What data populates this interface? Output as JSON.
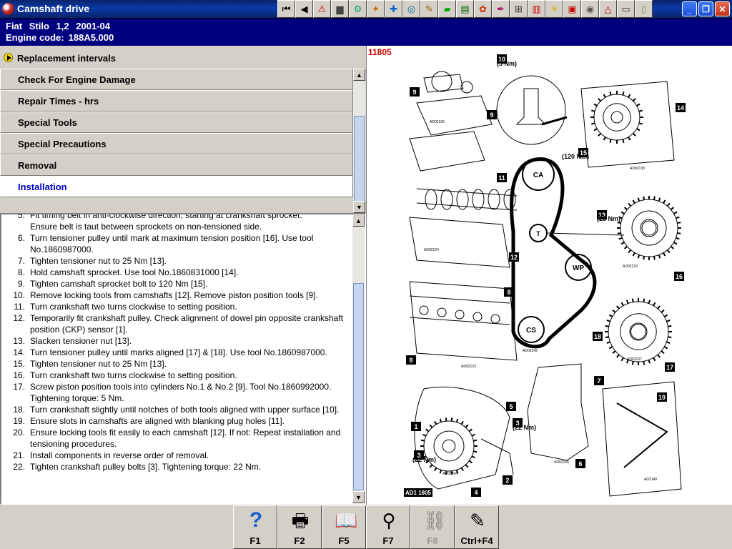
{
  "window": {
    "title": "Camshaft drive"
  },
  "toolbar": {
    "buttons": [
      {
        "name": "first-page-button",
        "glyph": "⏮"
      },
      {
        "name": "back-button",
        "glyph": "◀"
      },
      {
        "name": "warning-icon",
        "glyph": "⚠"
      },
      {
        "name": "book-icon",
        "glyph": "▆"
      },
      {
        "name": "settings-icon",
        "glyph": "⚙"
      },
      {
        "name": "engine-icon",
        "glyph": "✦"
      },
      {
        "name": "tool-icon",
        "glyph": "✚"
      },
      {
        "name": "gauge-icon",
        "glyph": "◎"
      },
      {
        "name": "diagnosis-icon",
        "glyph": "✎"
      },
      {
        "name": "car-icon",
        "glyph": "▰"
      },
      {
        "name": "battery-icon",
        "glyph": "▤"
      },
      {
        "name": "repair-icon",
        "glyph": "✿"
      },
      {
        "name": "wrench-icon",
        "glyph": "✒"
      },
      {
        "name": "counter-icon",
        "glyph": "⊞"
      },
      {
        "name": "electrical-icon",
        "glyph": "▥"
      },
      {
        "name": "lightbulb-icon",
        "glyph": "☀"
      },
      {
        "name": "vehicle-icon",
        "glyph": "▣"
      },
      {
        "name": "wheel-icon",
        "glyph": "◉"
      },
      {
        "name": "alignment-icon",
        "glyph": "△"
      },
      {
        "name": "truck-icon",
        "glyph": "▭"
      },
      {
        "name": "document-icon",
        "glyph": "▯"
      }
    ]
  },
  "vehicle": {
    "make": "Fiat",
    "model": "Stilo",
    "engine_size": "1,2",
    "years": "2001-04",
    "engine_code_label": "Engine code:",
    "engine_code": "188A5.000"
  },
  "menu": {
    "selected": "Replacement intervals",
    "items": [
      {
        "label": "Check For Engine Damage",
        "active": false
      },
      {
        "label": "Repair Times - hrs",
        "active": false
      },
      {
        "label": "Special Tools",
        "active": false
      },
      {
        "label": "Special Precautions",
        "active": false
      },
      {
        "label": "Removal",
        "active": false
      },
      {
        "label": "Installation",
        "active": true
      }
    ]
  },
  "instructions": {
    "steps": [
      {
        "num": "5.",
        "text": "Fit timing belt in anti-clockwise direction, starting at crankshaft sprocket."
      },
      {
        "num": "",
        "text": "Ensure belt is taut between sprockets on non-tensioned side."
      },
      {
        "num": "6.",
        "text": "Turn tensioner pulley until mark at maximum tension position [16]. Use tool No.1860987000."
      },
      {
        "num": "7.",
        "text": "Tighten tensioner nut to 25 Nm [13]."
      },
      {
        "num": "8.",
        "text": "Hold camshaft sprocket. Use tool No.1860831000 [14]."
      },
      {
        "num": "9.",
        "text": "Tighten camshaft sprocket bolt to 120 Nm [15]."
      },
      {
        "num": "10.",
        "text": "Remove locking tools from camshafts [12]. Remove piston position tools [9]."
      },
      {
        "num": "11.",
        "text": "Turn crankshaft two turns clockwise to setting position."
      },
      {
        "num": "12.",
        "text": "Temporarily fit crankshaft pulley. Check alignment of dowel pin opposite crankshaft position (CKP) sensor [1]."
      },
      {
        "num": "13.",
        "text": "Slacken tensioner nut [13]."
      },
      {
        "num": "14.",
        "text": "Turn tensioner pulley until marks aligned [17] & [18]. Use tool No.1860987000."
      },
      {
        "num": "15.",
        "text": "Tighten tensioner nut to 25 Nm [13]."
      },
      {
        "num": "16.",
        "text": "Turn crankshaft two turns clockwise to setting position."
      },
      {
        "num": "17.",
        "text": "Screw piston position tools into cylinders No.1 & No.2 [9]. Tool No.1860992000. Tightening torque: 5 Nm."
      },
      {
        "num": "18.",
        "text": "Turn crankshaft slightly until notches of both tools aligned with upper surface [10]."
      },
      {
        "num": "19.",
        "text": "Ensure slots in camshafts are aligned with blanking plug holes [11]."
      },
      {
        "num": "20.",
        "text": "Ensure locking tools fit easily to each camshaft [12]. If not: Repeat installation and tensioning procedures."
      },
      {
        "num": "21.",
        "text": "Install components in reverse order of removal."
      },
      {
        "num": "22.",
        "text": "Tighten crankshaft pulley bolts [3]. Tightening torque: 22 Nm."
      }
    ]
  },
  "diagram": {
    "code": "11805",
    "footer_code": "AD1 1805",
    "belt_labels": [
      "CA",
      "T",
      "WP",
      "CS"
    ],
    "callouts": [
      "10",
      "9",
      "9",
      "14",
      "15",
      "11",
      "13",
      "12",
      "16",
      "8",
      "18",
      "8",
      "17",
      "7",
      "5",
      "19",
      "1",
      "3",
      "3",
      "6",
      "2",
      "4"
    ],
    "torques": [
      "(5 Nm)",
      "(120 Nm)",
      "(25 Nm)",
      "(22 Nm)",
      "(22 Nm)"
    ],
    "small_codes": [
      "AD02136",
      "AD02130",
      "AD02124",
      "AD02129",
      "AD02142",
      "AD02123",
      "AD02137",
      "AD02100",
      "AD02094",
      "AD2149"
    ]
  },
  "function_keys": [
    {
      "label": "F1",
      "icon": "?",
      "name": "help-icon",
      "disabled": false
    },
    {
      "label": "F2",
      "icon": "🖶",
      "name": "print-icon",
      "disabled": false
    },
    {
      "label": "F5",
      "icon": "📖",
      "name": "book-icon",
      "disabled": false
    },
    {
      "label": "F7",
      "icon": "⚲",
      "name": "zoom-icon",
      "disabled": false
    },
    {
      "label": "F8",
      "icon": "⛓",
      "name": "belt-icon",
      "disabled": true
    },
    {
      "label": "Ctrl+F4",
      "icon": "✎",
      "name": "notes-icon",
      "disabled": false
    }
  ]
}
